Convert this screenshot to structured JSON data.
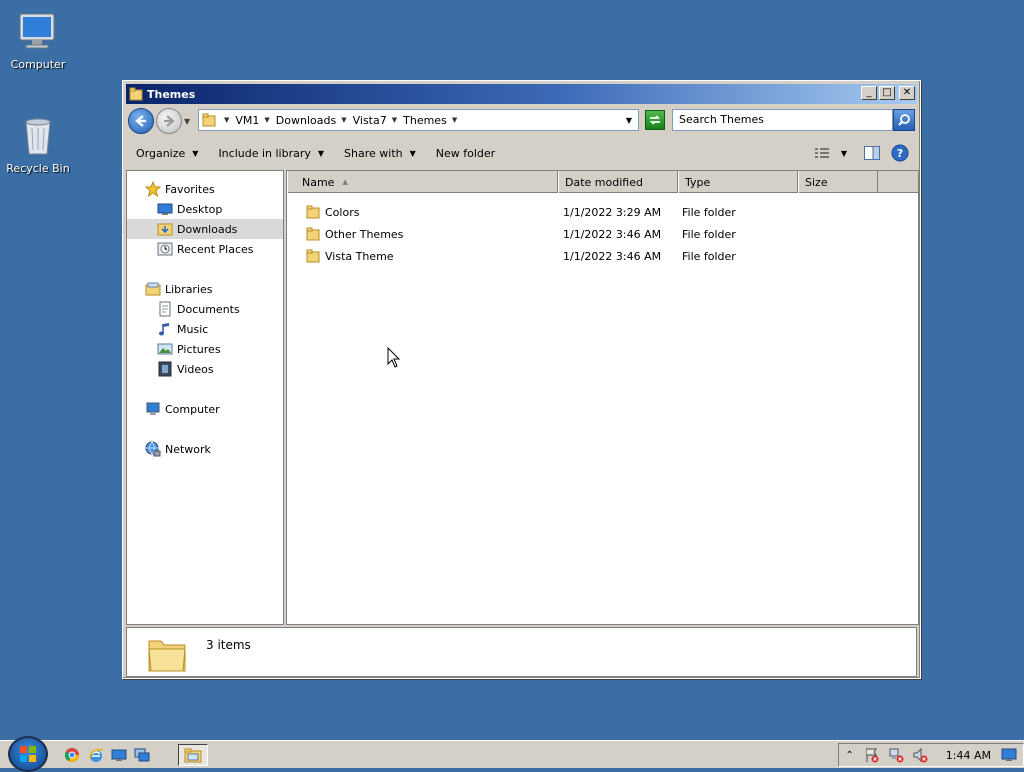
{
  "desktop": {
    "icons": [
      {
        "label": "Computer"
      },
      {
        "label": "Recycle Bin"
      }
    ]
  },
  "window": {
    "title": "Themes",
    "caption_buttons": {
      "minimize": "_",
      "maximize": "□",
      "close": "✕"
    },
    "address": {
      "crumbs": [
        "VM1",
        "Downloads",
        "Vista7",
        "Themes"
      ]
    },
    "search": {
      "placeholder": "Search Themes"
    },
    "toolbar": {
      "organize": "Organize",
      "include": "Include in library",
      "share": "Share with",
      "new_folder": "New folder"
    },
    "nav": {
      "favorites": "Favorites",
      "desktop": "Desktop",
      "downloads": "Downloads",
      "recent": "Recent Places",
      "libraries": "Libraries",
      "documents": "Documents",
      "music": "Music",
      "pictures": "Pictures",
      "videos": "Videos",
      "computer": "Computer",
      "network": "Network"
    },
    "columns": {
      "name": "Name",
      "date": "Date modified",
      "type": "Type",
      "size": "Size"
    },
    "files": [
      {
        "name": "Colors",
        "date": "1/1/2022 3:29 AM",
        "type": "File folder"
      },
      {
        "name": "Other Themes",
        "date": "1/1/2022 3:46 AM",
        "type": "File folder"
      },
      {
        "name": "Vista Theme",
        "date": "1/1/2022 3:46 AM",
        "type": "File folder"
      }
    ],
    "details": {
      "count": "3 items"
    }
  },
  "taskbar": {
    "clock": "1:44 AM"
  },
  "colors": {
    "desktop": "#3a6ea5",
    "title_start": "#0a246a",
    "title_end": "#a6caf0",
    "chrome": "#d4d0c8"
  }
}
